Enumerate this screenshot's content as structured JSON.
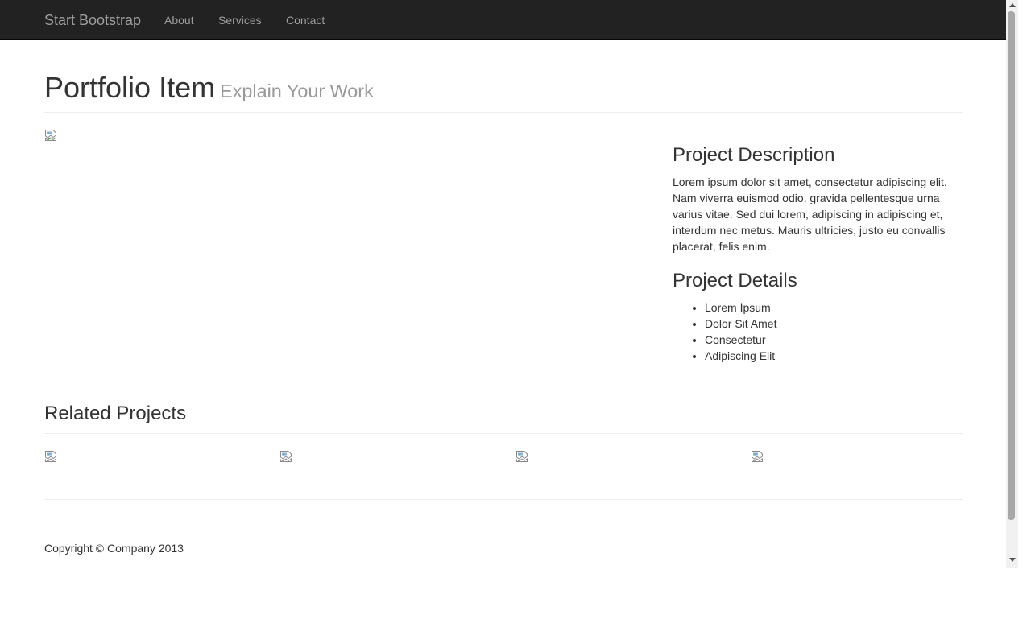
{
  "navbar": {
    "brand": "Start Bootstrap",
    "links": [
      "About",
      "Services",
      "Contact"
    ]
  },
  "header": {
    "title": "Portfolio Item",
    "subtitle": "Explain Your Work"
  },
  "project": {
    "description_heading": "Project Description",
    "description": "Lorem ipsum dolor sit amet, consectetur adipiscing elit. Nam viverra euismod odio, gravida pellentesque urna varius vitae. Sed dui lorem, adipiscing in adipiscing et, interdum nec metus. Mauris ultricies, justo eu convallis placerat, felis enim.",
    "details_heading": "Project Details",
    "details": [
      "Lorem Ipsum",
      "Dolor Sit Amet",
      "Consectetur",
      "Adipiscing Elit"
    ]
  },
  "related": {
    "heading": "Related Projects"
  },
  "footer": {
    "copyright": "Copyright © Company 2013"
  },
  "icons": {
    "broken_image": "broken-image-icon"
  },
  "colors": {
    "navbar_bg": "#222222",
    "nav_text": "#9d9d9d",
    "text": "#333333",
    "muted": "#999999",
    "rule": "#eeeeee"
  }
}
